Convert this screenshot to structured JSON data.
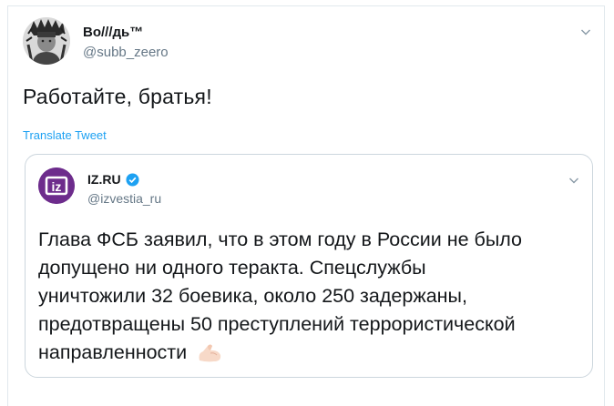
{
  "tweet": {
    "author_name": "Во///дь™",
    "author_handle": "@subb_zeero",
    "text": "Работайте, братья!",
    "translate_label": "Translate Tweet"
  },
  "quoted": {
    "name": "IZ.RU",
    "handle": "@izvestia_ru",
    "logo_text": "iz",
    "lines": [
      "Глава ФСБ заявил, что в этом году в России не было",
      "допущено ни одного теракта. Спецслужбы",
      "уничтожили 32 боевика, около 250 задержаны,",
      "предотвращены 50 преступлений террористической",
      "направленности"
    ],
    "emoji": "flexed-biceps"
  },
  "colors": {
    "accent": "#1da1f2",
    "handle": "#657786",
    "border": "#ccd6dd",
    "iz_brand": "#6d2c8c"
  },
  "icons": [
    "chevron-down-icon",
    "verified-badge-icon",
    "flexed-biceps-emoji"
  ]
}
